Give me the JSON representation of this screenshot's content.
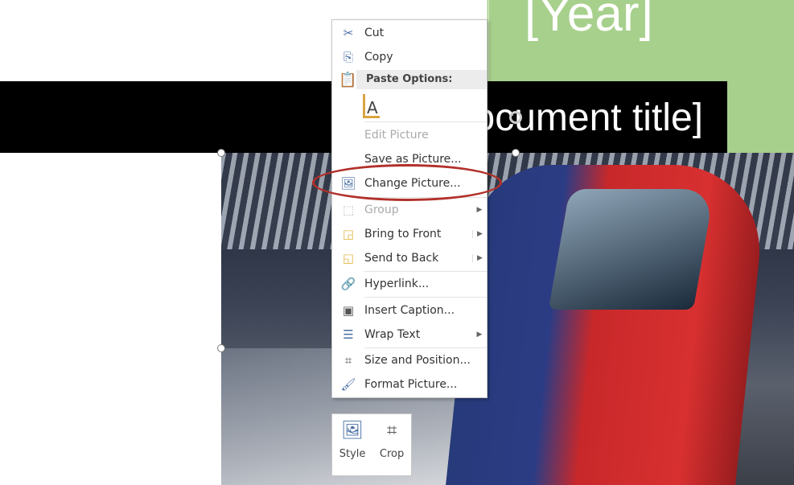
{
  "document": {
    "year_placeholder": "[Year]",
    "title_placeholder": "[Document title]"
  },
  "context_menu": {
    "items": [
      {
        "label": "Cut",
        "icon": "scissors-icon",
        "enabled": true
      },
      {
        "label": "Copy",
        "icon": "copy-icon",
        "enabled": true
      },
      {
        "label": "Edit Picture",
        "icon": "",
        "enabled": false
      },
      {
        "label": "Save as Picture...",
        "icon": "",
        "enabled": true
      },
      {
        "label": "Change Picture...",
        "icon": "change-picture-icon",
        "enabled": true,
        "highlighted": true
      },
      {
        "label": "Group",
        "icon": "group-icon",
        "enabled": false,
        "submenu": true
      },
      {
        "label": "Bring to Front",
        "icon": "bring-to-front-icon",
        "enabled": true,
        "submenu": true
      },
      {
        "label": "Send to Back",
        "icon": "send-to-back-icon",
        "enabled": true,
        "submenu": true
      },
      {
        "label": "Hyperlink...",
        "icon": "hyperlink-icon",
        "enabled": true
      },
      {
        "label": "Insert Caption...",
        "icon": "caption-icon",
        "enabled": true
      },
      {
        "label": "Wrap Text",
        "icon": "wrap-text-icon",
        "enabled": true,
        "submenu": true
      },
      {
        "label": "Size and Position...",
        "icon": "size-position-icon",
        "enabled": true
      },
      {
        "label": "Format Picture...",
        "icon": "format-picture-icon",
        "enabled": true
      }
    ],
    "paste_options_header": "Paste Options:",
    "paste_option_icon": "keep-text-only-icon"
  },
  "mini_toolbar": {
    "style_label": "Style",
    "crop_label": "Crop"
  },
  "colors": {
    "accent_green": "#a8d08d",
    "annotation_ring": "#b2302a"
  }
}
